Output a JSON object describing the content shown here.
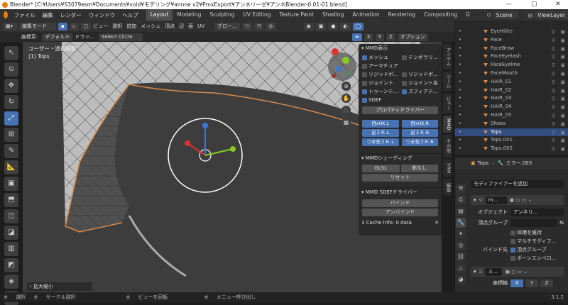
{
  "window": {
    "title": "Blender* [C:¥Users¥S3079esm¥Documents¥void¥モデリング¥annne v2¥PmxExport¥アンネリーゼ¥アンネBlender-0.01-01.blend]",
    "minimize": "—",
    "maximize": "▢",
    "close": "✕"
  },
  "menu": {
    "items": [
      "ファイル",
      "編集",
      "レンダー",
      "ウィンドウ",
      "ヘルプ"
    ],
    "workspaces": [
      "Layout",
      "Modeling",
      "Sculpting",
      "UV Editing",
      "Texture Paint",
      "Shading",
      "Animation",
      "Rendering",
      "Compositing",
      "G"
    ],
    "active_workspace": "Layout",
    "scene": "Scene",
    "view_layer": "ViewLayer"
  },
  "header": {
    "mode": "編集モード",
    "menus": [
      "ビュー",
      "選択",
      "追加",
      "メッシュ",
      "頂点",
      "辺",
      "面",
      "UV"
    ],
    "transform_orientation": "グロー...",
    "options": "オプション",
    "axes": [
      "X",
      "Y",
      "Z"
    ]
  },
  "tool_settings": {
    "orientation_label": "座標系:",
    "orientation_value": "デフォルト",
    "drag_label": "ドラッ...",
    "select_tool": "Select Circle"
  },
  "viewport": {
    "view_name": "ユーザー・透視投影",
    "object_info": "(1) Tops",
    "bottom_hint": "拡大縮小"
  },
  "mmd_display": {
    "header": "MMD表示",
    "checkboxes": [
      {
        "label": "メッシュ",
        "checked": true
      },
      {
        "label": "テンポラリ...",
        "checked": false
      },
      {
        "label": "アーマチュア",
        "checked": false
      },
      {
        "label": "",
        "checked": false
      },
      {
        "label": "リジッドボ...",
        "checked": false
      },
      {
        "label": "リジッドボ...",
        "checked": false
      },
      {
        "label": "ジョイント",
        "checked": false
      },
      {
        "label": "ジョイント名",
        "checked": false
      },
      {
        "label": "トゥーンテ...",
        "checked": true
      },
      {
        "label": "スフィアテ...",
        "checked": true
      },
      {
        "label": "SDEF",
        "checked": true
      }
    ],
    "property_driver": "プロパティドライバー",
    "ik_buttons": [
      "目x(IK.L",
      "目x(IK.R",
      "足ＩＫ.L",
      "足ＩＫ.R",
      "つま先ＩＫ.L",
      "つま先ＩＫ.R"
    ]
  },
  "mmd_shading": {
    "header": "MMDシェーディング",
    "glsl": "GLSL",
    "shadeless": "影なし",
    "reset": "リセット"
  },
  "mmd_sdef": {
    "header": "MMD SDEFドライバー",
    "bind": "バインド",
    "unbind": "アンバインド",
    "cache_info": "Cache Info: 0 data"
  },
  "sidebar_tabs": [
    "アイテム",
    "ツール",
    "ビュー",
    "MMD",
    "その他",
    "VRM",
    "編集"
  ],
  "active_sidebar_tab": "MMD",
  "outliner": {
    "items": [
      {
        "name": "EyeHilite",
        "selected": false
      },
      {
        "name": "Face",
        "selected": false
      },
      {
        "name": "FaceBrow",
        "selected": false
      },
      {
        "name": "FaceEyelash",
        "selected": false
      },
      {
        "name": "FaceEyeline",
        "selected": false
      },
      {
        "name": "FaceMouth",
        "selected": false
      },
      {
        "name": "HAIR_01",
        "selected": false
      },
      {
        "name": "HAIR_02",
        "selected": false
      },
      {
        "name": "HAIR_03",
        "selected": false
      },
      {
        "name": "HAIR_04",
        "selected": false
      },
      {
        "name": "HAIR_05",
        "selected": false
      },
      {
        "name": "Shoes",
        "selected": false
      },
      {
        "name": "Tops",
        "selected": true
      },
      {
        "name": "Tops.001",
        "selected": false
      },
      {
        "name": "Tops.002",
        "selected": false
      }
    ]
  },
  "properties": {
    "object_name": "Tops",
    "modifier_name": "ミラー.003",
    "add_modifier": "モディファイアーを追加",
    "mod1_name": "m...",
    "object_label": "オブジェクト",
    "object_value": "アンネリ...",
    "vgroup_label": "頂点グループ",
    "keep_volume": "体積を維持",
    "multi_modifier": "マルチモディフ...",
    "bind_to_label": "バインド先",
    "bind_vgroup": "頂点グループ",
    "bone_envelope": "ボーンエンベロ...",
    "mod2_name": "ミ...",
    "axis_label": "座標軸",
    "axes": [
      "X",
      "Y",
      "Z"
    ]
  },
  "status": {
    "select": "選択",
    "circle_select": "サークル選択",
    "rotate_view": "ビューを回転",
    "call_menu": "メニュー呼び出し",
    "version": "3.1.2"
  }
}
